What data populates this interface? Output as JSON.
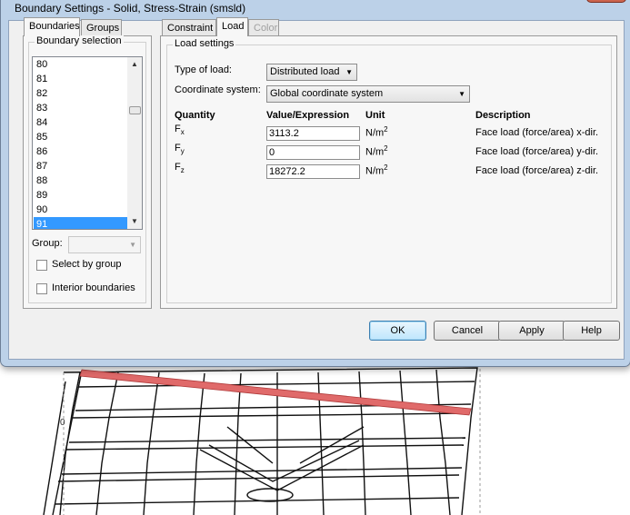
{
  "window": {
    "title": "Boundary Settings - Solid, Stress-Strain (smsld)",
    "close_glyph": "x"
  },
  "left_tabs": [
    {
      "label": "Boundaries"
    },
    {
      "label": "Groups"
    }
  ],
  "boundary_selection": {
    "label": "Boundary selection",
    "items": [
      "80",
      "81",
      "82",
      "83",
      "84",
      "85",
      "86",
      "87",
      "88",
      "89",
      "90",
      "91"
    ],
    "selected": "91"
  },
  "group": {
    "label": "Group:",
    "value": ""
  },
  "checkboxes": [
    {
      "label": "Select by group",
      "checked": false
    },
    {
      "label": "Interior boundaries",
      "checked": false
    }
  ],
  "right_tabs": [
    {
      "label": "Constraint"
    },
    {
      "label": "Load",
      "active": true
    },
    {
      "label": "Color",
      "disabled": true
    }
  ],
  "load_settings": {
    "legend": "Load settings",
    "type_of_load_label": "Type of load:",
    "type_of_load_value": "Distributed load",
    "coord_label": "Coordinate system:",
    "coord_value": "Global coordinate system"
  },
  "table": {
    "headers": {
      "quantity": "Quantity",
      "value": "Value/Expression",
      "unit": "Unit",
      "description": "Description"
    },
    "rows": [
      {
        "symbol": "F",
        "sub": "x",
        "value": "3113.2",
        "unit": "N/m",
        "unit_sup": "2",
        "description": "Face load (force/area) x-dir."
      },
      {
        "symbol": "F",
        "sub": "y",
        "value": "0",
        "unit": "N/m",
        "unit_sup": "2",
        "description": "Face load (force/area) y-dir."
      },
      {
        "symbol": "F",
        "sub": "z",
        "value": "18272.2",
        "unit": "N/m",
        "unit_sup": "2",
        "description": "Face load (force/area) z-dir."
      }
    ]
  },
  "buttons": {
    "ok": "OK",
    "cancel": "Cancel",
    "apply": "Apply",
    "help": "Help"
  },
  "background": {
    "axis_label": "0"
  },
  "colors": {
    "selection": "#3399ff",
    "highlight_edge": "#e06a6a",
    "dialog_frame": "#bcd1e8"
  }
}
